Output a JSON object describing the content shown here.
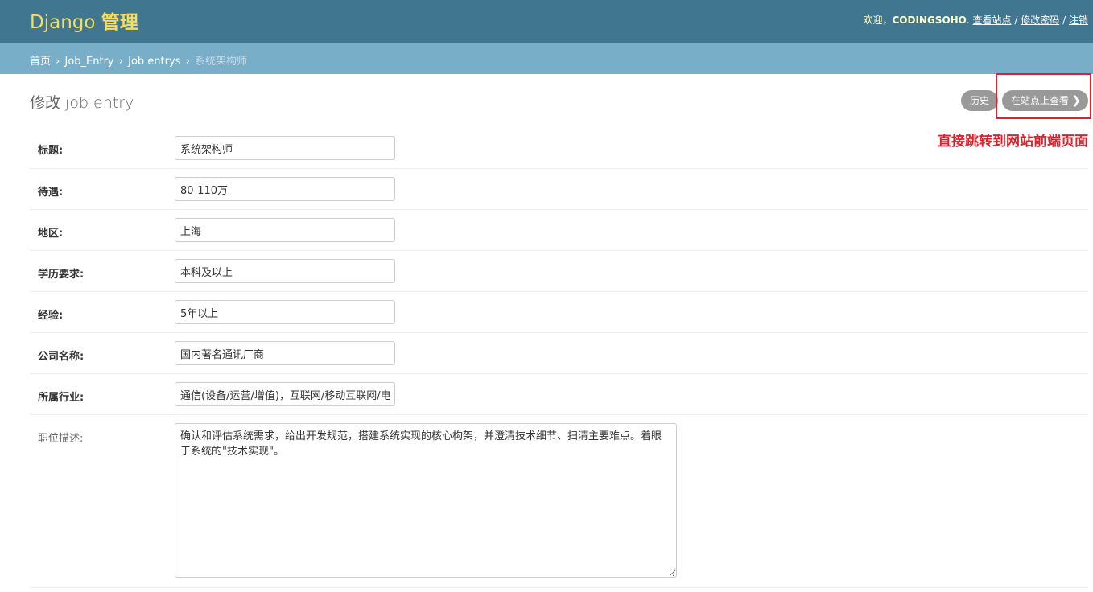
{
  "header": {
    "brand_en": "Django ",
    "brand_zh": "管理",
    "welcome": "欢迎，",
    "username": "CODINGSOHO",
    "period": ".",
    "view_site": "查看站点",
    "separator": "/",
    "change_password": "修改密码",
    "logout": "注销"
  },
  "breadcrumbs": {
    "home": "首页",
    "arrow": "›",
    "app": "Job_Entry",
    "model": "Job entrys",
    "current": "系统架构师"
  },
  "content": {
    "title": "修改 job entry",
    "history_button": "历史",
    "view_on_site_button": "在站点上查看",
    "view_on_site_chevron": "❯",
    "annotation": "直接跳转到网站前端页面"
  },
  "form": {
    "fields": [
      {
        "label": "标题:",
        "value": "系统架构师"
      },
      {
        "label": "待遇:",
        "value": "80-110万"
      },
      {
        "label": "地区:",
        "value": "上海"
      },
      {
        "label": "学历要求:",
        "value": "本科及以上"
      },
      {
        "label": "经验:",
        "value": "5年以上"
      },
      {
        "label": "公司名称:",
        "value": "国内著名通讯厂商"
      },
      {
        "label": "所属行业:",
        "value": "通信(设备/运营/增值)，互联网/移动互联网/电"
      }
    ],
    "description": {
      "label": "职位描述:",
      "value": "确认和评估系统需求，给出开发规范，搭建系统实现的核心构架，并澄清技术细节、扫清主要难点。着眼于系统的\"技术实现\"。"
    }
  },
  "colors": {
    "header_bg": "#417690",
    "brand": "#f5dd5d",
    "breadcrumbs_bg": "#79aec8",
    "annotation_red": "#e0202a",
    "button_gray": "#999999"
  }
}
